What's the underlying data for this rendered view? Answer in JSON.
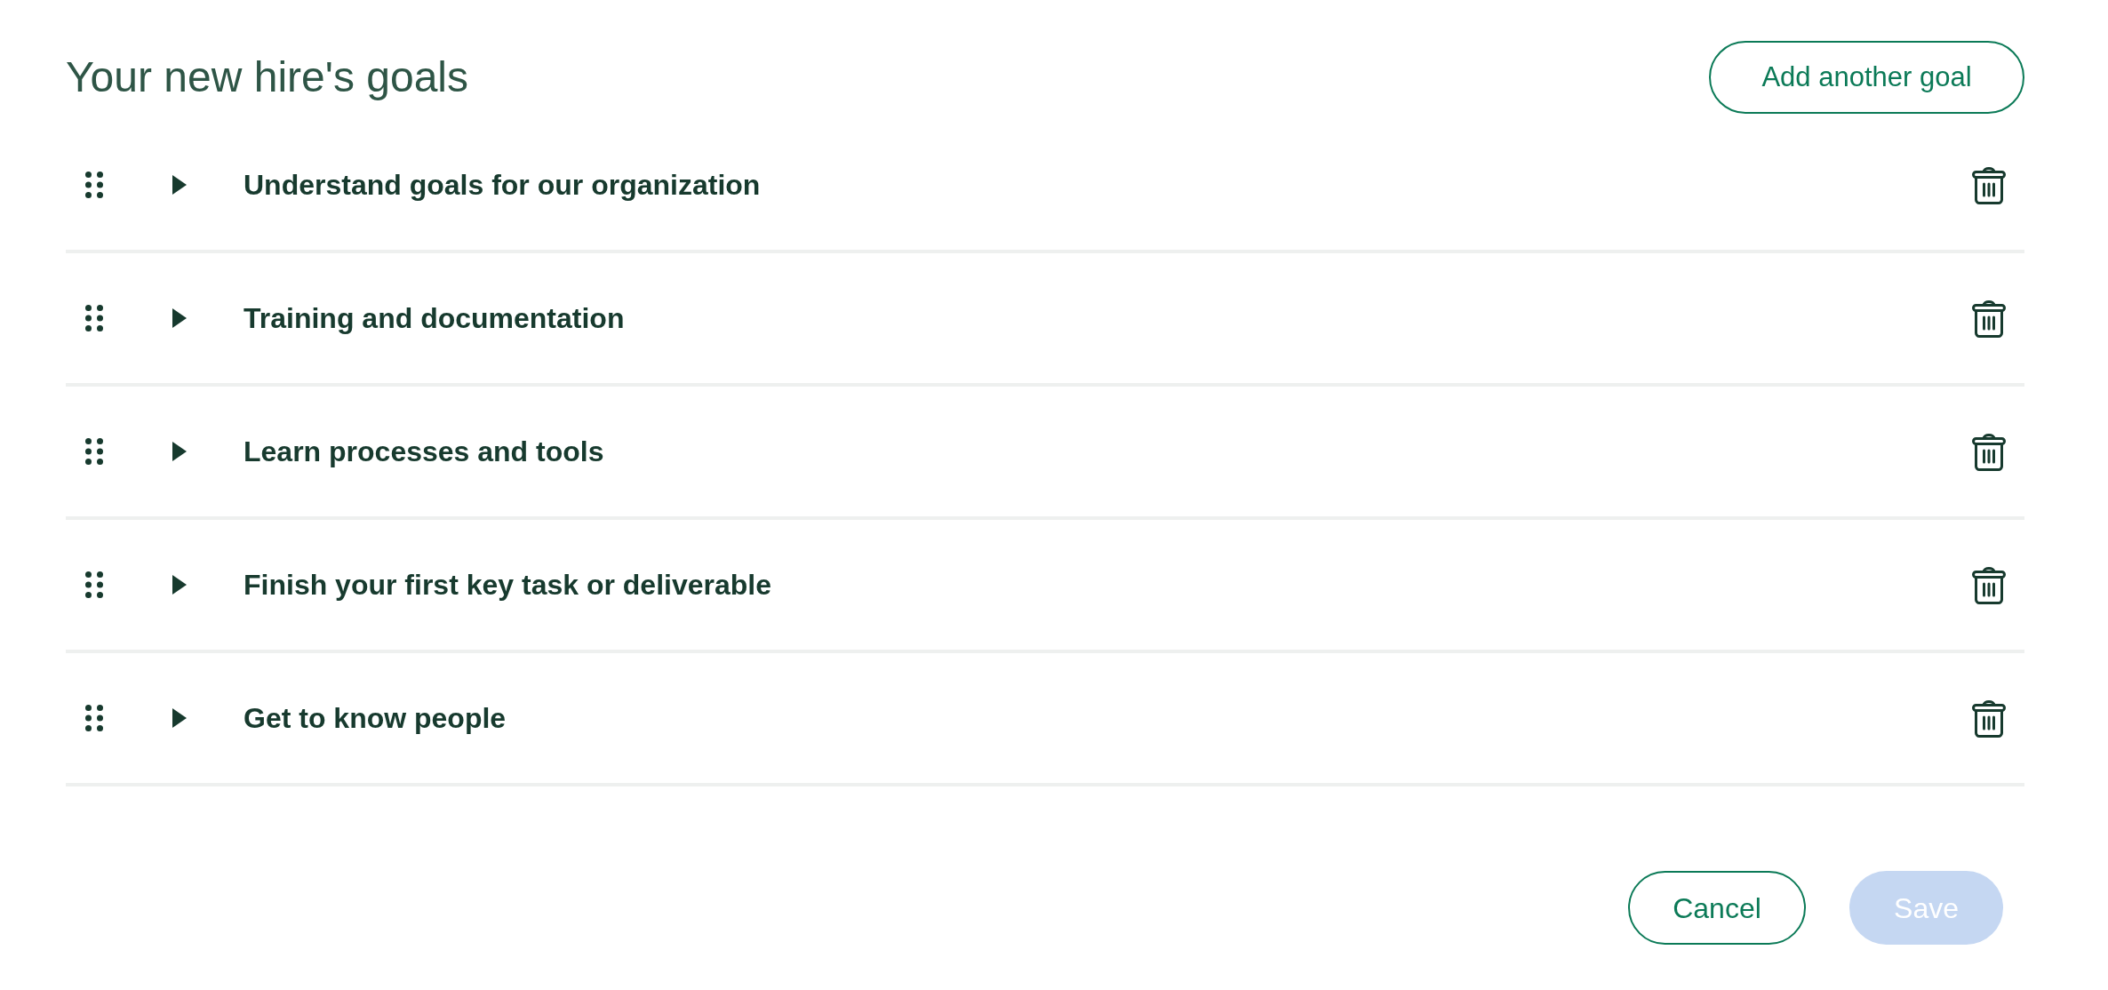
{
  "header": {
    "title": "Your new hire's goals",
    "add_button": "Add another goal"
  },
  "goals": [
    {
      "title": "Understand goals for our organization",
      "expanded": false
    },
    {
      "title": "Training and documentation",
      "expanded": false
    },
    {
      "title": "Learn processes and tools",
      "expanded": false
    },
    {
      "title": "Finish your first key task or deliverable",
      "expanded": false
    },
    {
      "title": "Get to know people",
      "expanded": false
    }
  ],
  "footer": {
    "cancel": "Cancel",
    "save": {
      "label": "Save",
      "disabled": true
    }
  }
}
